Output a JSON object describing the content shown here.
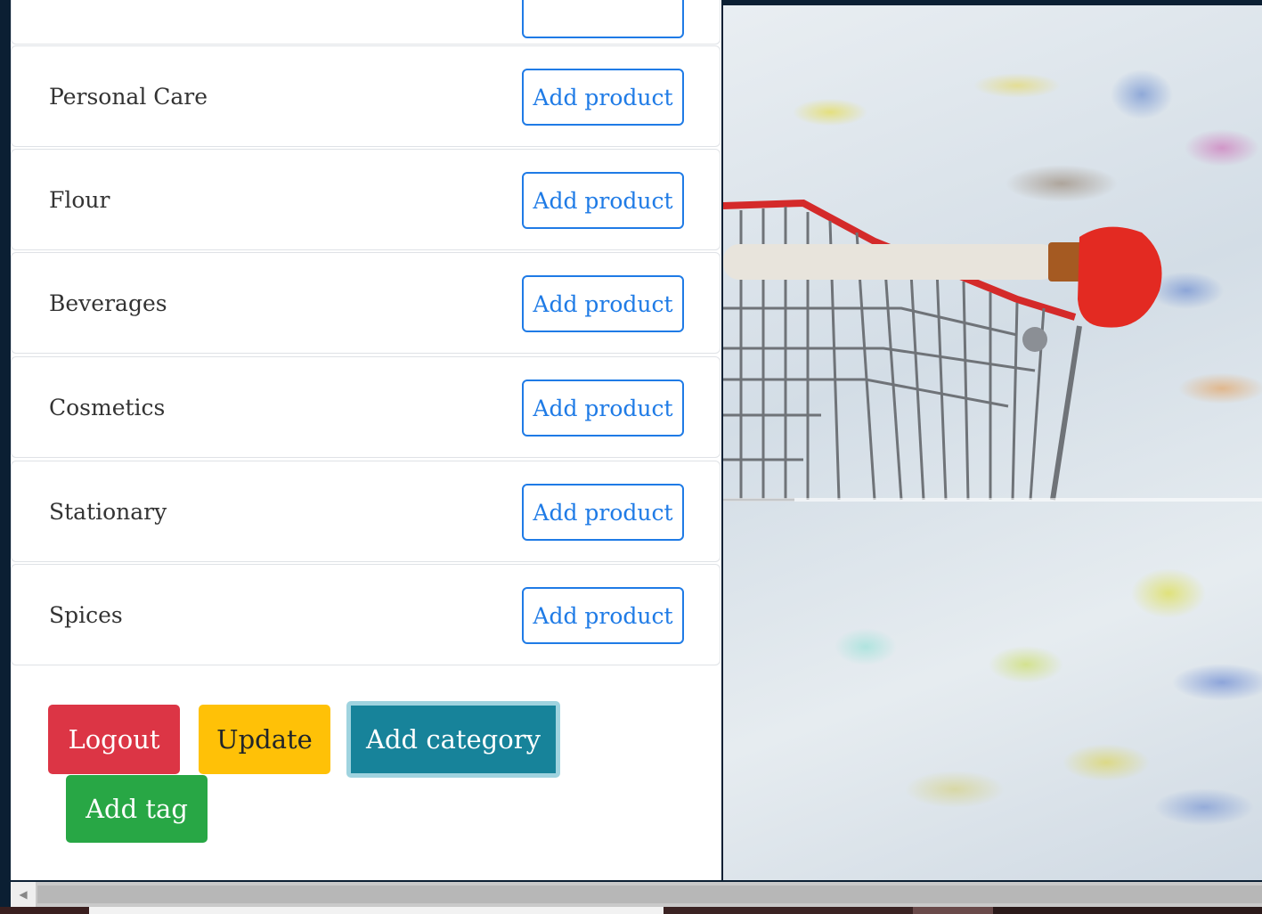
{
  "categories": [
    {
      "label": "",
      "button": ""
    },
    {
      "label": "Personal Care",
      "button": "Add product"
    },
    {
      "label": "Flour",
      "button": "Add product"
    },
    {
      "label": "Beverages",
      "button": "Add product"
    },
    {
      "label": "Cosmetics",
      "button": "Add product"
    },
    {
      "label": "Stationary",
      "button": "Add product"
    },
    {
      "label": "Spices",
      "button": "Add product"
    }
  ],
  "actions": {
    "logout": "Logout",
    "update": "Update",
    "add_category": "Add category",
    "add_tag": "Add tag"
  },
  "colors": {
    "primary": "#1f7be6",
    "danger": "#dc3545",
    "warning": "#ffc107",
    "info": "#17839a",
    "success": "#28a745"
  },
  "scrollbar": {
    "left_arrow": "◀"
  }
}
